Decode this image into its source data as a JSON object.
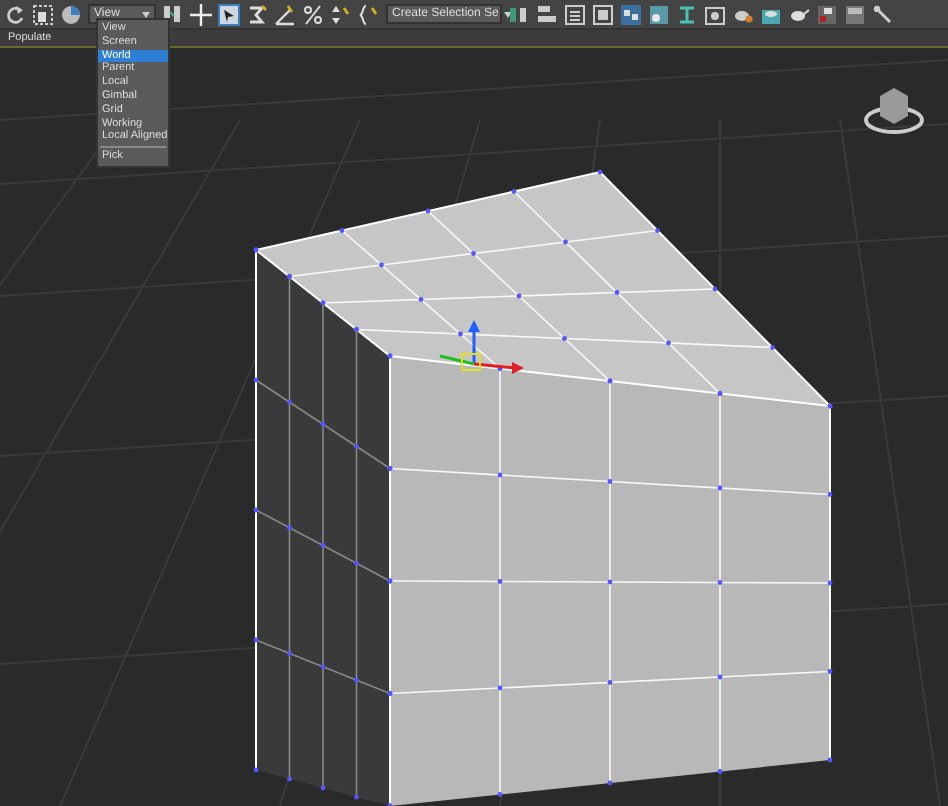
{
  "toolbar": {
    "coordinate_dropdown": {
      "value": "View"
    },
    "selection_set_dropdown": {
      "value": "Create Selection Se"
    }
  },
  "ribbon": {
    "tabs": [
      {
        "label": "Populate",
        "selected": true
      }
    ]
  },
  "coordinate_menu": {
    "items": [
      {
        "label": "View",
        "selected": false
      },
      {
        "label": "Screen",
        "selected": false
      },
      {
        "label": "World",
        "selected": true
      },
      {
        "label": "Parent",
        "selected": false
      },
      {
        "label": "Local",
        "selected": false
      },
      {
        "label": "Gimbal",
        "selected": false
      },
      {
        "label": "Grid",
        "selected": false
      },
      {
        "label": "Working",
        "selected": false
      },
      {
        "label": "Local Aligned",
        "selected": false
      },
      {
        "label": "Pick",
        "selected": false
      }
    ]
  }
}
